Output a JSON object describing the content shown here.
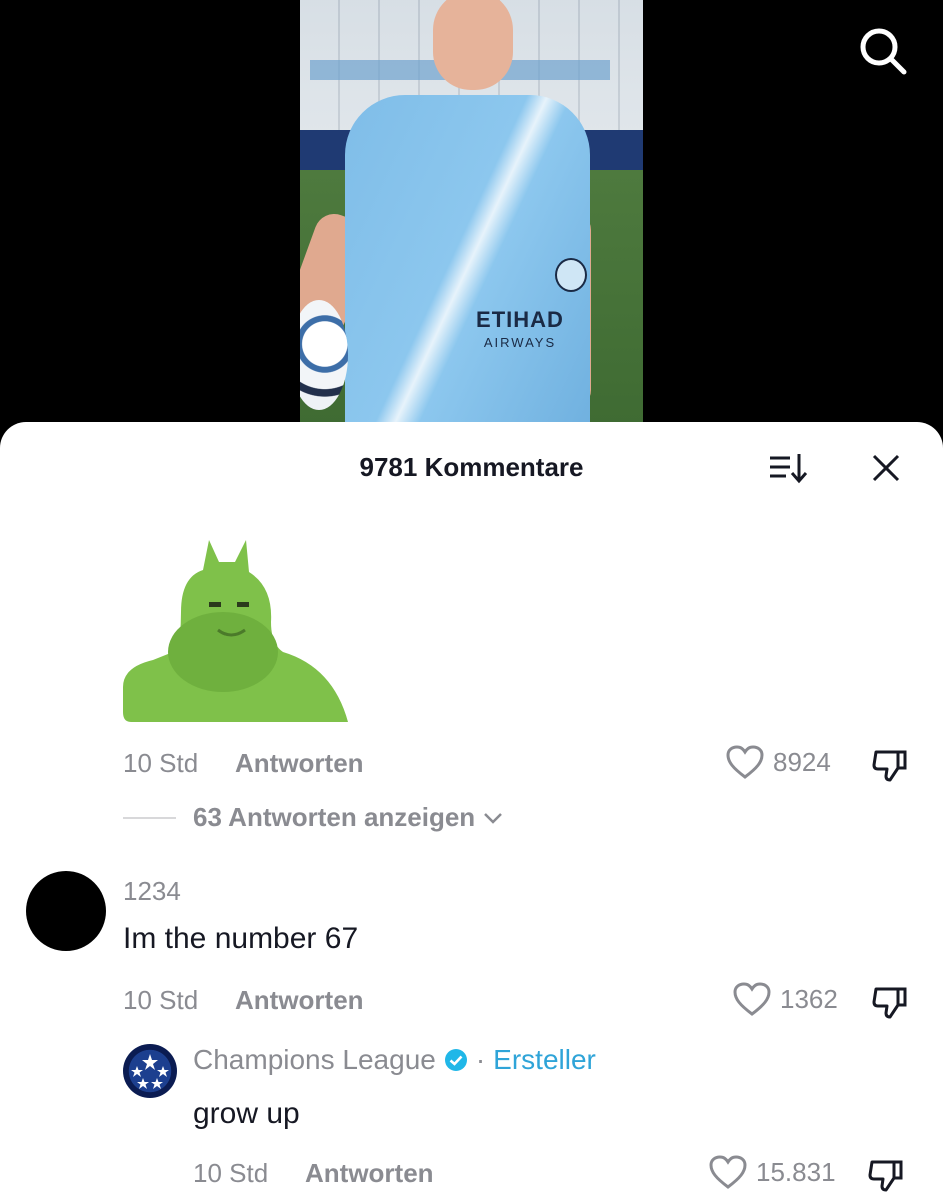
{
  "header": {
    "comments_title": "9781 Kommentare"
  },
  "video": {
    "sponsor_main": "ETIHAD",
    "sponsor_sub": "AIRWAYS"
  },
  "comments": [
    {
      "type": "sticker",
      "time": "10 Std",
      "reply_label": "Antworten",
      "likes": "8924",
      "view_replies": "63 Antworten anzeigen"
    },
    {
      "username": "1234",
      "text": "Im the number 67",
      "time": "10 Std",
      "reply_label": "Antworten",
      "likes": "1362"
    }
  ],
  "reply": {
    "username": "Champions League",
    "separator": "·",
    "badge": "Ersteller",
    "text": "grow up",
    "time": "10 Std",
    "reply_label": "Antworten",
    "likes": "15.831"
  },
  "colors": {
    "accent_blue": "#2fa4d8",
    "muted_text": "#8a8b91",
    "primary_text": "#161823"
  },
  "icons": [
    "search-icon",
    "sort-icon",
    "close-icon",
    "heart-icon",
    "dislike-icon",
    "chevron-down-icon",
    "verified-icon"
  ]
}
